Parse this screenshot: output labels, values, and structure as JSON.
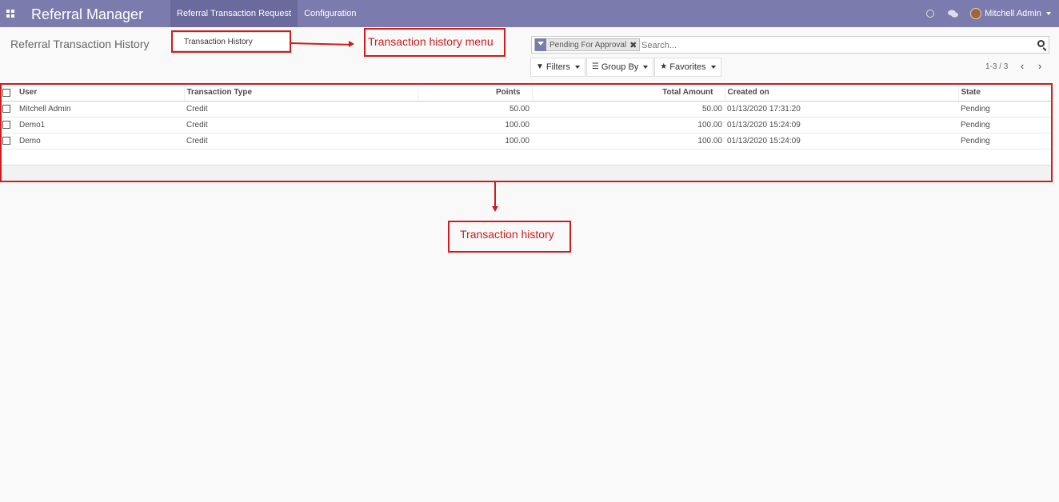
{
  "navbar": {
    "app_title": "Referral Manager",
    "menu": [
      {
        "label": "Referral Transaction Request",
        "active": true
      },
      {
        "label": "Configuration",
        "active": false
      }
    ],
    "user_name": "Mitchell Admin"
  },
  "dropdown": {
    "item": "Transaction History"
  },
  "control_panel": {
    "breadcrumb": "Referral Transaction History",
    "facet_label": "Pending For Approval",
    "search_placeholder": "Search...",
    "filters_label": "Filters",
    "group_by_label": "Group By",
    "favorites_label": "Favorites",
    "pager_value": "1-3 / 3"
  },
  "table": {
    "columns": [
      "User",
      "Transaction Type",
      "Points",
      "Total Amount",
      "Created on",
      "State"
    ],
    "rows": [
      {
        "user": "Mitchell Admin",
        "type": "Credit",
        "points": "50.00",
        "amount": "50.00",
        "created": "01/13/2020 17:31:20",
        "state": "Pending"
      },
      {
        "user": "Demo1",
        "type": "Credit",
        "points": "100.00",
        "amount": "100.00",
        "created": "01/13/2020 15:24:09",
        "state": "Pending"
      },
      {
        "user": "Demo",
        "type": "Credit",
        "points": "100.00",
        "amount": "100.00",
        "created": "01/13/2020 15:24:09",
        "state": "Pending"
      }
    ]
  },
  "annotations": {
    "menu_label": "Transaction history menu",
    "table_label": "Transaction history"
  },
  "colors": {
    "navbar": "#7c7bad",
    "annotation": "#d01c1c"
  }
}
